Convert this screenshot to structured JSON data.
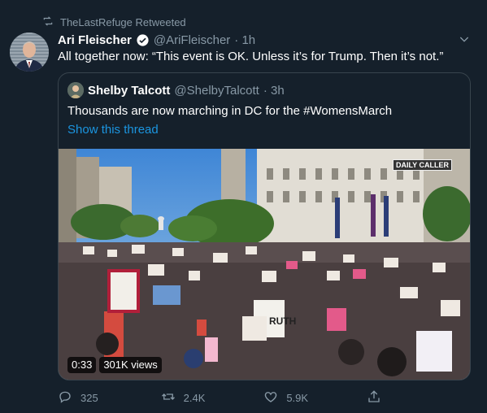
{
  "retweet": {
    "text": "TheLastRefuge Retweeted"
  },
  "tweet": {
    "author_name": "Ari Fleischer",
    "author_handle": "@AriFleischer",
    "time": "· 1h",
    "text": "All together now: “This event is OK.  Unless it’s for Trump.  Then it’s not.”"
  },
  "quoted": {
    "author_name": "Shelby Talcott",
    "author_handle": "@ShelbyTalcott",
    "time": "· 3h",
    "text": "Thousands are now marching in DC for the #WomensMarch",
    "thread_link": "Show this thread",
    "video": {
      "watermark": "DAILY CALLER",
      "duration": "0:33",
      "views": "301K views",
      "sign_text": "RUTH"
    }
  },
  "actions": {
    "replies": "325",
    "retweets": "2.4K",
    "likes": "5.9K"
  },
  "colors": {
    "background": "#15202b",
    "link": "#1b95e0",
    "muted": "#8899a6"
  }
}
